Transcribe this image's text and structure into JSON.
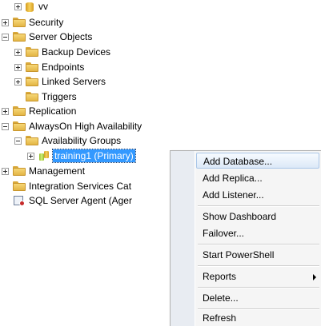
{
  "tree": {
    "vv": "vv",
    "security": "Security",
    "server_objects": "Server Objects",
    "backup_devices": "Backup Devices",
    "endpoints": "Endpoints",
    "linked_servers": "Linked Servers",
    "triggers": "Triggers",
    "replication": "Replication",
    "alwayson": "AlwaysOn High Availability",
    "availability_groups": "Availability Groups",
    "training1": "training1 (Primary)",
    "management": "Management",
    "integration_services": "Integration Services Cat",
    "sql_server_agent": "SQL Server Agent (Ager"
  },
  "context_menu": {
    "items": [
      "Add Database...",
      "Add Replica...",
      "Add Listener...",
      "Show Dashboard",
      "Failover...",
      "Start PowerShell",
      "Reports",
      "Delete...",
      "Refresh"
    ]
  },
  "colors": {
    "selection": "#3399ff",
    "menu_highlight": "#dce9f7",
    "folder": "#f6d777"
  },
  "icons": {
    "folder": "folder-icon",
    "database": "database-icon",
    "availability_group": "availability-group-icon",
    "agent": "sql-agent-icon",
    "expand": "expand-icon",
    "collapse": "collapse-icon",
    "submenu": "submenu-arrow-icon"
  }
}
